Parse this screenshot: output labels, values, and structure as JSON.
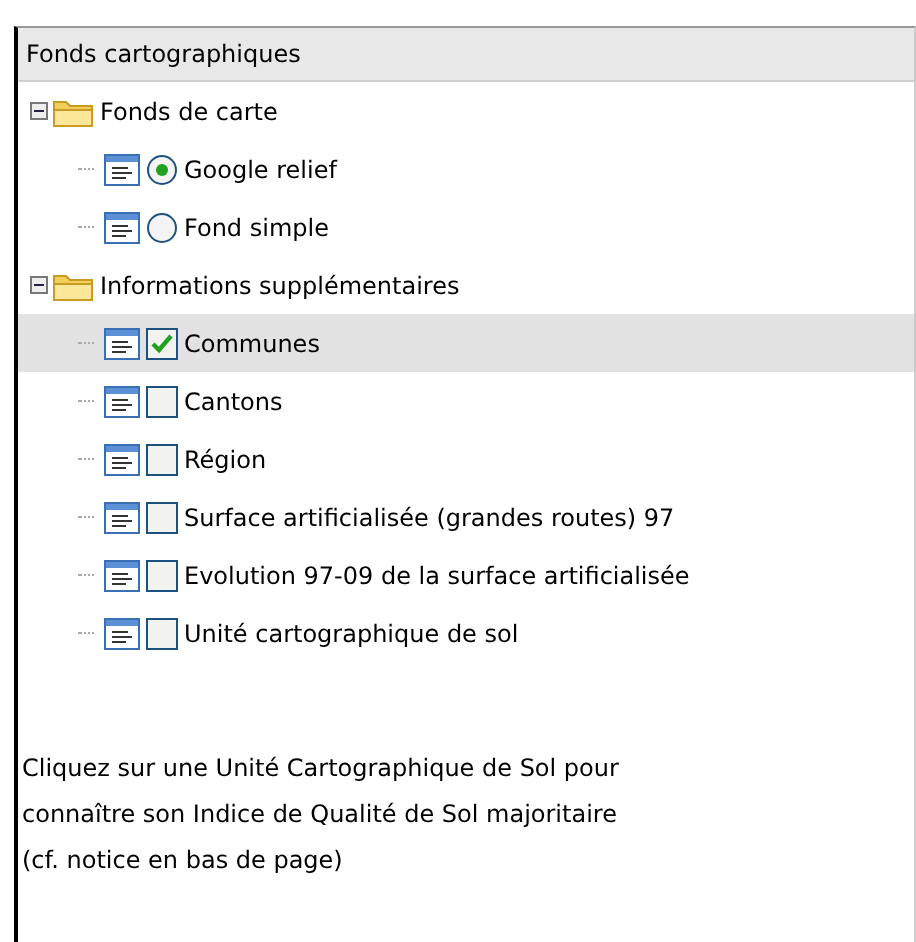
{
  "panel": {
    "title": "Fonds cartographiques"
  },
  "tree": [
    {
      "label": "Fonds de carte",
      "expanded": true,
      "children": [
        {
          "label": "Google relief",
          "kind": "radio",
          "checked": true,
          "selected": false
        },
        {
          "label": "Fond simple",
          "kind": "radio",
          "checked": false,
          "selected": false
        }
      ]
    },
    {
      "label": "Informations supplémentaires",
      "expanded": true,
      "children": [
        {
          "label": "Communes",
          "kind": "checkbox",
          "checked": true,
          "selected": true
        },
        {
          "label": "Cantons",
          "kind": "checkbox",
          "checked": false,
          "selected": false
        },
        {
          "label": "Région",
          "kind": "checkbox",
          "checked": false,
          "selected": false
        },
        {
          "label": "Surface artificialisée (grandes routes) 97",
          "kind": "checkbox",
          "checked": false,
          "selected": false
        },
        {
          "label": "Evolution 97-09 de la surface artificialisée",
          "kind": "checkbox",
          "checked": false,
          "selected": false
        },
        {
          "label": "Unité cartographique de sol",
          "kind": "checkbox",
          "checked": false,
          "selected": false
        }
      ]
    }
  ],
  "note": [
    "Cliquez sur une Unité Cartographique de Sol pour",
    "connaître son Indice de Qualité de Sol majoritaire",
    "(cf. notice en bas de page)"
  ]
}
